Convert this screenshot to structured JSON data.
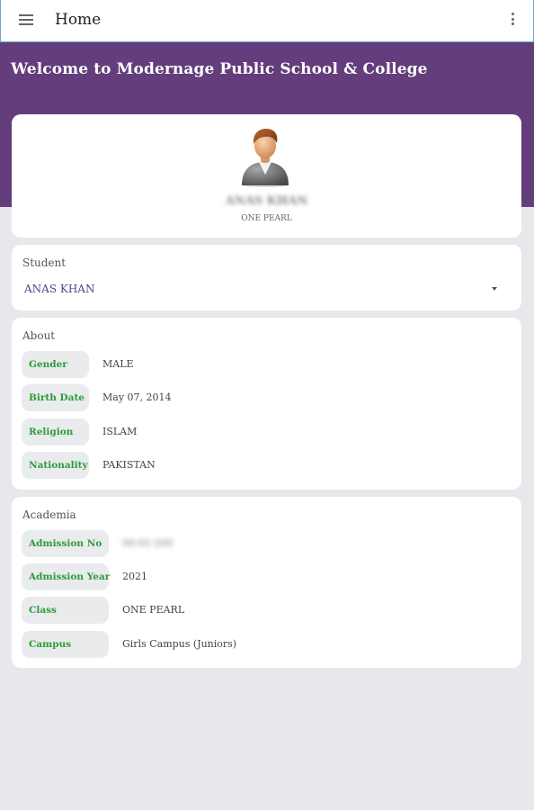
{
  "appbar": {
    "title": "Home",
    "menu_icon": "hamburger-menu-icon",
    "more_icon": "more-vert-icon"
  },
  "hero": {
    "welcome": "Welcome to Modernage Public School & College"
  },
  "profile": {
    "avatar_icon": "user-avatar-icon",
    "name": "ANAS KHAN",
    "class": "ONE PEARL"
  },
  "student": {
    "label": "Student",
    "selected": "ANAS KHAN"
  },
  "about": {
    "label": "About",
    "rows": [
      {
        "key": "Gender",
        "value": "MALE"
      },
      {
        "key": "Birth Date",
        "value": "May 07, 2014"
      },
      {
        "key": "Religion",
        "value": "ISLAM"
      },
      {
        "key": "Nationality",
        "value": "PAKISTAN"
      }
    ]
  },
  "academia": {
    "label": "Academia",
    "rows": [
      {
        "key": "Admission No",
        "value": "00-01-200"
      },
      {
        "key": "Admission Year",
        "value": "2021"
      },
      {
        "key": "Class",
        "value": "ONE PEARL"
      },
      {
        "key": "Campus",
        "value": "Girls Campus (Juniors)"
      }
    ]
  },
  "colors": {
    "primary": "#633d7c",
    "accent_text": "#2c9b3a",
    "background": "#e8e8ec"
  }
}
